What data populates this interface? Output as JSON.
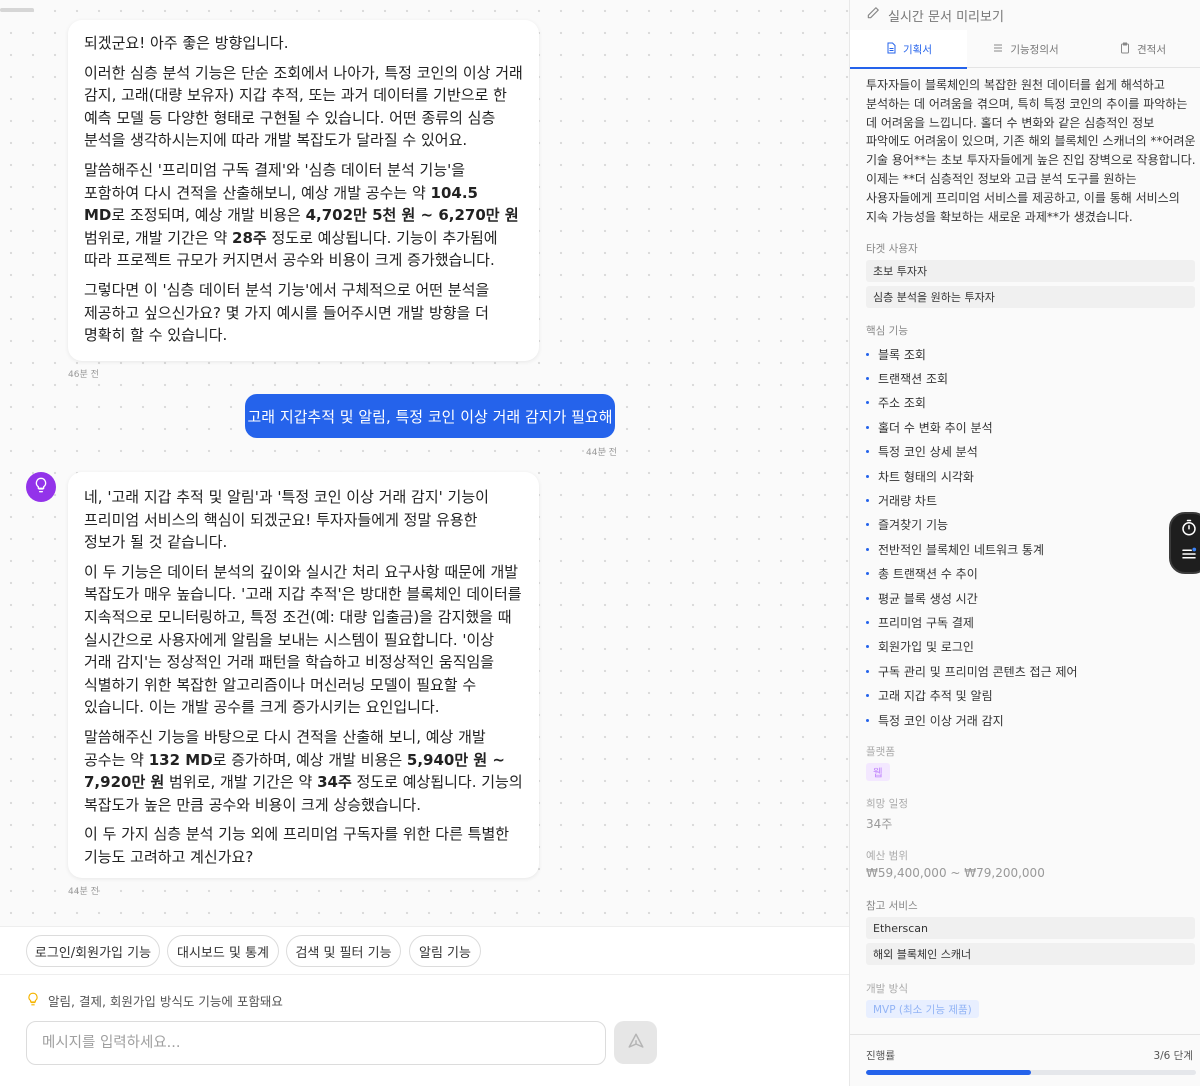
{
  "chat": {
    "bubble1": {
      "p1": "되겠군요! 아주 좋은 방향입니다.",
      "p2": "이러한 심층 분석 기능은 단순 조회에서 나아가, 특정 코인의 이상 거래 감지, 고래(대량 보유자) 지갑 추적, 또는 과거 데이터를 기반으로 한 예측 모델 등 다양한 형태로 구현될 수 있습니다. 어떤 종류의 심층 분석을 생각하시는지에 따라 개발 복잡도가 달라질 수 있어요.",
      "p3_a": "말씀해주신 '프리미엄 구독 결제'와 '심층 데이터 분석 기능'을 포함하여 다시 견적을 산출해보니, 예상 개발 공수는 약 ",
      "p3_b1": "104.5 MD",
      "p3_c": "로 조정되며, 예상 개발 비용은 ",
      "p3_b2": "4,702만 5천 원 ~ 6,270만 원",
      "p3_d": " 범위로, 개발 기간은 약 ",
      "p3_b3": "28주",
      "p3_e": " 정도로 예상됩니다. 기능이 추가됨에 따라 프로젝트 규모가 커지면서 공수와 비용이 크게 증가했습니다.",
      "p4": "그렇다면 이 '심층 데이터 분석 기능'에서 구체적으로 어떤 분석을 제공하고 싶으신가요? 몇 가지 예시를 들어주시면 개발 방향을 더 명확히 할 수 있습니다.",
      "time": "46분 전"
    },
    "user_msg": {
      "text": "고래 지갑추적 및 알림, 특정 코인 이상 거래 감지가 필요해",
      "time": "44분 전"
    },
    "bubble2": {
      "p1": "네, '고래 지갑 추적 및 알림'과 '특정 코인 이상 거래 감지' 기능이 프리미엄 서비스의 핵심이 되겠군요! 투자자들에게 정말 유용한 정보가 될 것 같습니다.",
      "p2": "이 두 기능은 데이터 분석의 깊이와 실시간 처리 요구사항 때문에 개발 복잡도가 매우 높습니다. '고래 지갑 추적'은 방대한 블록체인 데이터를 지속적으로 모니터링하고, 특정 조건(예: 대량 입출금)을 감지했을 때 실시간으로 사용자에게 알림을 보내는 시스템이 필요합니다. '이상 거래 감지'는 정상적인 거래 패턴을 학습하고 비정상적인 움직임을 식별하기 위한 복잡한 알고리즘이나 머신러닝 모델이 필요할 수 있습니다. 이는 개발 공수를 크게 증가시키는 요인입니다.",
      "p3_a": "말씀해주신 기능을 바탕으로 다시 견적을 산출해 보니, 예상 개발 공수는 약 ",
      "p3_b1": "132 MD",
      "p3_c": "로 증가하며, 예상 개발 비용은 ",
      "p3_b2": "5,940만 원 ~ 7,920만 원",
      "p3_d": " 범위로, 개발 기간은 약 ",
      "p3_b3": "34주",
      "p3_e": " 정도로 예상됩니다. 기능의 복잡도가 높은 만큼 공수와 비용이 크게 상승했습니다.",
      "p4": "이 두 가지 심층 분석 기능 외에 프리미엄 구독자를 위한 다른 특별한 기능도 고려하고 계신가요?",
      "time": "44분 전"
    },
    "chips": [
      "로그인/회원가입 기능",
      "대시보드 및 통계",
      "검색 및 필터 기능",
      "알림 기능"
    ],
    "hint": "알림, 결제, 회원가입 방식도 기능에 포함돼요",
    "input_placeholder": "메시지를 입력하세요..."
  },
  "panel": {
    "header": "실시간 문서 미리보기",
    "tabs": [
      "기획서",
      "기능정의서",
      "견적서"
    ],
    "description": "투자자들이 블록체인의 복잡한 원천 데이터를 쉽게 해석하고 분석하는 데 어려움을 겪으며, 특히 특정 코인의 추이를 파악하는 데 어려움을 느낍니다. 홀더 수 변화와 같은 심층적인 정보 파악에도 어려움이 있으며, 기존 해외 블록체인 스캐너의 **어려운 기술 용어**는 초보 투자자들에게 높은 진입 장벽으로 작용합니다. 이제는 **더 심층적인 정보와 고급 분석 도구를 원하는 사용자들에게 프리미엄 서비스를 제공하고, 이를 통해 서비스의 지속 가능성을 확보하는 새로운 과제**가 생겼습니다.",
    "target_label": "타겟 사용자",
    "targets": [
      "초보 투자자",
      "심층 분석을 원하는 투자자"
    ],
    "features_label": "핵심 기능",
    "features": [
      "블록 조회",
      "트랜잭션 조회",
      "주소 조회",
      "홀더 수 변화 추이 분석",
      "특정 코인 상세 분석",
      "차트 형태의 시각화",
      "거래량 차트",
      "즐겨찾기 기능",
      "전반적인 블록체인 네트워크 통계",
      "총 트랜잭션 수 추이",
      "평균 블록 생성 시간",
      "프리미엄 구독 결제",
      "회원가입 및 로그인",
      "구독 관리 및 프리미엄 콘텐츠 접근 제어",
      "고래 지갑 추적 및 알림",
      "특정 코인 이상 거래 감지"
    ],
    "platform_label": "플랫폼",
    "platform": "웹",
    "schedule_label": "희망 일정",
    "schedule": "34주",
    "budget_label": "예산 범위",
    "budget": "₩59,400,000 ~ ₩79,200,000",
    "ref_label": "참고 서비스",
    "refs": [
      "Etherscan",
      "해외 블록체인 스캐너"
    ],
    "method_label": "개발 방식",
    "method": "MVP (최소 기능 제품)",
    "progress_label": "진행률",
    "progress_text": "3/6 단계",
    "progress_fraction": 0.5,
    "colors": {
      "accent": "#2563eb",
      "avatar": "#9333ea"
    }
  }
}
